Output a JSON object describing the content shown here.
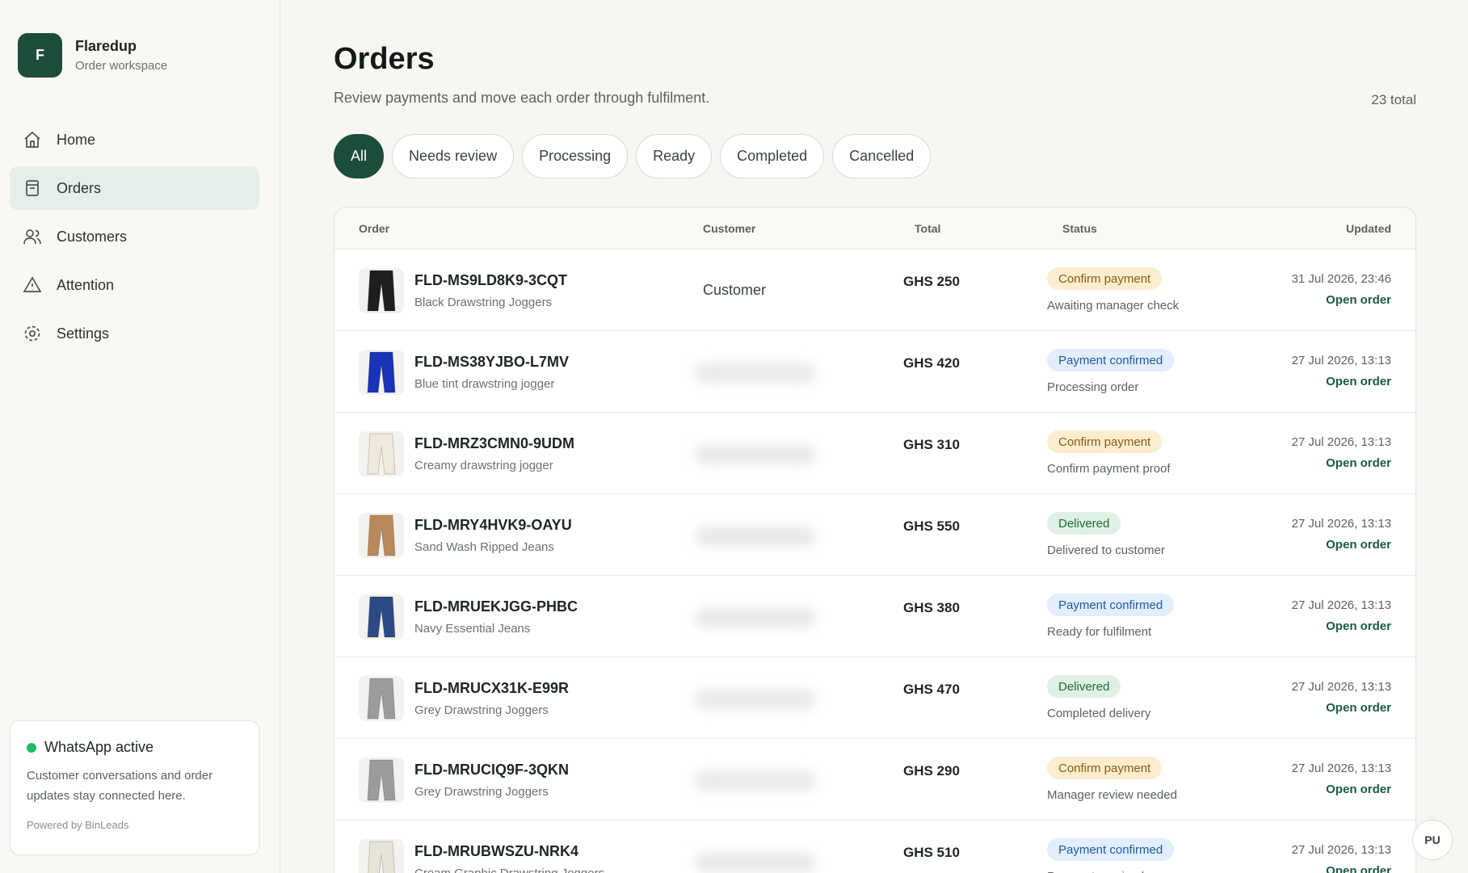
{
  "brand": {
    "logo_letter": "F",
    "name": "Flaredup",
    "subtitle": "Order workspace"
  },
  "nav": [
    {
      "label": "Home",
      "icon": "home-icon"
    },
    {
      "label": "Orders",
      "icon": "orders-icon",
      "active": true
    },
    {
      "label": "Customers",
      "icon": "customers-icon"
    },
    {
      "label": "Attention",
      "icon": "warning-icon"
    },
    {
      "label": "Settings",
      "icon": "gear-icon"
    }
  ],
  "whatsapp": {
    "title": "WhatsApp active",
    "description": "Customer conversations and order updates stay connected here.",
    "powered": "Powered by BinLeads",
    "status_color": "#22b96a"
  },
  "page": {
    "title": "Orders",
    "subtitle": "Review payments and move each order through fulfilment.",
    "total": "23 total"
  },
  "filters": [
    "All",
    "Needs review",
    "Processing",
    "Ready",
    "Completed",
    "Cancelled"
  ],
  "table": {
    "headers": {
      "order": "Order",
      "customer": "Customer",
      "total": "Total",
      "status": "Status",
      "updated": "Updated"
    },
    "rows": [
      {
        "id": "FLD-MS9LD8K9-3CQT",
        "item": "Black Drawstring Joggers",
        "customer": "Customer",
        "total": "GHS 250",
        "status": "Confirm payment",
        "status_kind": "pending",
        "note": "Awaiting manager check",
        "updated": "31 Jul 2026, 23:46",
        "action": "Open order",
        "thumb_color": "#1e1e1e"
      },
      {
        "id": "FLD-MS38YJBO-L7MV",
        "item": "Blue tint drawstring jogger",
        "customer": "",
        "total": "GHS 420",
        "status": "Payment confirmed",
        "status_kind": "confirmed",
        "note": "Processing order",
        "updated": "27 Jul 2026, 13:13",
        "action": "Open order",
        "thumb_color": "#1833b8"
      },
      {
        "id": "FLD-MRZ3CMN0-9UDM",
        "item": "Creamy drawstring jogger",
        "customer": "",
        "total": "GHS 310",
        "status": "Confirm payment",
        "status_kind": "pending",
        "note": "Confirm payment proof",
        "updated": "27 Jul 2026, 13:13",
        "action": "Open order",
        "thumb_color": "#efe9dc"
      },
      {
        "id": "FLD-MRY4HVK9-OAYU",
        "item": "Sand Wash Ripped Jeans",
        "customer": "",
        "total": "GHS 550",
        "status": "Delivered",
        "status_kind": "delivered",
        "note": "Delivered to customer",
        "updated": "27 Jul 2026, 13:13",
        "action": "Open order",
        "thumb_color": "#b8895c"
      },
      {
        "id": "FLD-MRUEKJGG-PHBC",
        "item": "Navy Essential Jeans",
        "customer": "",
        "total": "GHS 380",
        "status": "Payment confirmed",
        "status_kind": "confirmed",
        "note": "Ready for fulfilment",
        "updated": "27 Jul 2026, 13:13",
        "action": "Open order",
        "thumb_color": "#2c4a86"
      },
      {
        "id": "FLD-MRUCX31K-E99R",
        "item": "Grey Drawstring Joggers",
        "customer": "",
        "total": "GHS 470",
        "status": "Delivered",
        "status_kind": "delivered",
        "note": "Completed delivery",
        "updated": "27 Jul 2026, 13:13",
        "action": "Open order",
        "thumb_color": "#9a9c9e"
      },
      {
        "id": "FLD-MRUCIQ9F-3QKN",
        "item": "Grey Drawstring Joggers",
        "customer": "",
        "total": "GHS 290",
        "status": "Confirm payment",
        "status_kind": "pending",
        "note": "Manager review needed",
        "updated": "27 Jul 2026, 13:13",
        "action": "Open order",
        "thumb_color": "#9a9c9e"
      },
      {
        "id": "FLD-MRUBWSZU-NRK4",
        "item": "Cream Graphic Drawstring Joggers",
        "customer": "",
        "total": "GHS 510",
        "status": "Payment confirmed",
        "status_kind": "confirmed",
        "note": "Payment received",
        "updated": "27 Jul 2026, 13:13",
        "action": "Open order",
        "thumb_color": "#e8e4da"
      }
    ]
  },
  "user": {
    "initials": "PU"
  },
  "colors": {
    "brand": "#1c4d3a",
    "accent_link": "#1c5a3f"
  }
}
